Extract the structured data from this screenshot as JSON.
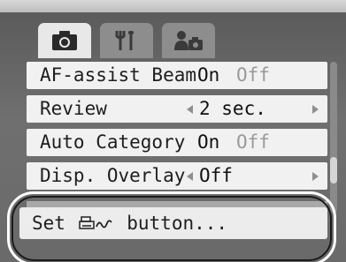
{
  "tabs": [
    {
      "icon": "camera-icon",
      "state": "active"
    },
    {
      "icon": "tools-icon",
      "state": "inactive"
    },
    {
      "icon": "my-camera-icon",
      "state": "inactive"
    }
  ],
  "menu": {
    "rows": [
      {
        "label": "AF-assist Beam",
        "on": "On",
        "off": "Off"
      },
      {
        "label": "Review",
        "value": "2 sec."
      },
      {
        "label": "Auto Category",
        "on": "On",
        "off": "Off"
      },
      {
        "label": "Disp. Overlay",
        "value": "Off"
      }
    ],
    "selected": {
      "label_prefix": "Set",
      "label_suffix": "button...",
      "icon": "print-share-icon"
    }
  },
  "colors": {
    "row_bg": "#f1f1f1",
    "off_text": "#9a9a9a",
    "screen_bg": "#6e6e6e",
    "ring": "#ffffff"
  }
}
